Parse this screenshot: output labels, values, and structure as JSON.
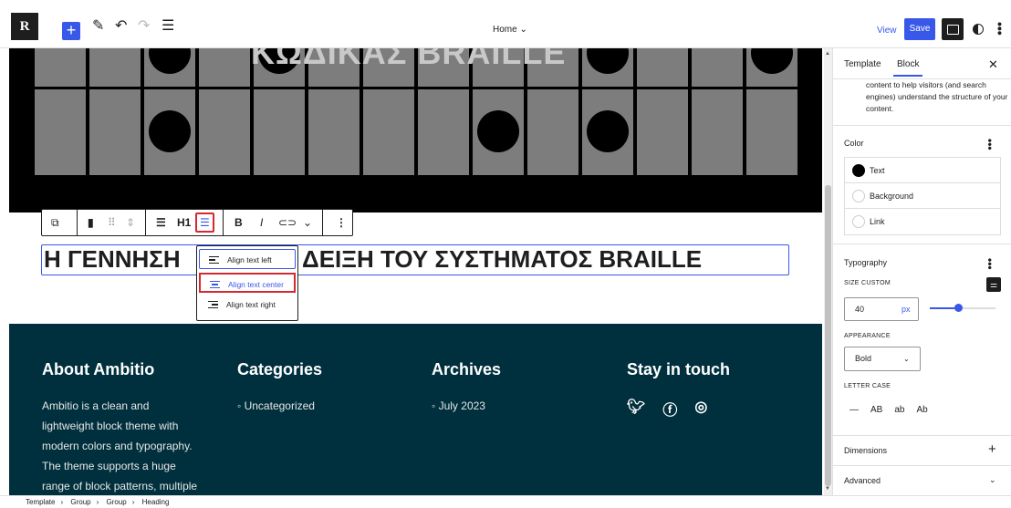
{
  "topbar": {
    "logo": "R",
    "title": "Home",
    "view": "View",
    "save": "Save"
  },
  "hero": {
    "title": "ΚΩΔΙΚΑΣ BRAILLE"
  },
  "toolbar": {
    "heading_level": "H1",
    "bold": "B",
    "italic": "I"
  },
  "heading": {
    "text_left": "Η ΓΕΝΝΗΣΗ",
    "text_right": "ΔΕΙΞΗ ΤΟΥ ΣΥΣΤΗΜΑΤΟΣ BRAILLE"
  },
  "align_menu": {
    "items": [
      "Align text left",
      "Align text center",
      "Align text right"
    ],
    "selected": "Align text center"
  },
  "footer": {
    "about": {
      "title": "About Ambitio",
      "lines": [
        "Ambitio is a clean and",
        "lightweight block theme with",
        "modern colors and typography.",
        "The theme supports a huge",
        "range of block patterns, multiple"
      ]
    },
    "categories": {
      "title": "Categories",
      "items": [
        "Uncategorized"
      ]
    },
    "archives": {
      "title": "Archives",
      "items": [
        "July 2023"
      ]
    },
    "social": {
      "title": "Stay in touch",
      "icons": [
        "twitter-icon",
        "facebook-icon",
        "instagram-icon"
      ]
    }
  },
  "sidebar": {
    "tabs": [
      "Template",
      "Block"
    ],
    "active_tab": "Block",
    "description": "content to help visitors (and search engines) understand the structure of your content.",
    "color": {
      "title": "Color",
      "items": [
        "Text",
        "Background",
        "Link"
      ]
    },
    "typography": {
      "title": "Typography",
      "size_label": "SIZE CUSTOM",
      "size_value": "40",
      "size_unit": "px",
      "size_fraction": 0.43,
      "appearance_label": "APPEARANCE",
      "appearance_value": "Bold",
      "letter_case_label": "LETTER CASE",
      "letter_case": [
        "—",
        "AB",
        "ab",
        "Ab"
      ]
    },
    "dimensions": "Dimensions",
    "advanced": "Advanced"
  },
  "breadcrumb": [
    "Template",
    "Group",
    "Group",
    "Heading"
  ],
  "colors": {
    "accent": "#3858e9",
    "highlight": "#d7282f",
    "footer_bg": "#00303e"
  }
}
